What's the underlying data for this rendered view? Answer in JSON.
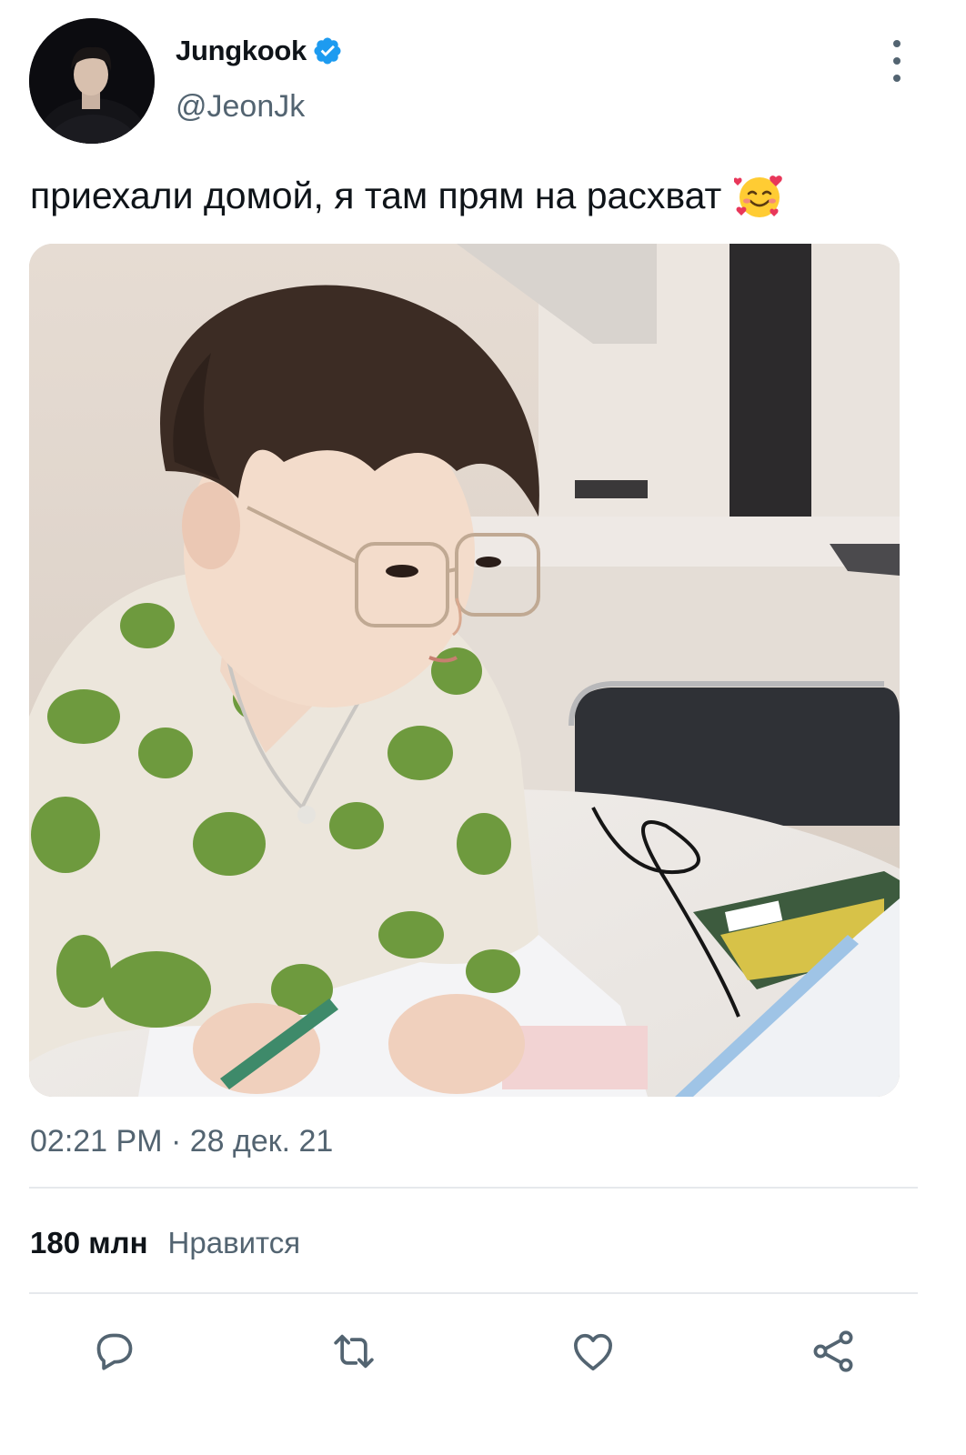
{
  "author": {
    "display_name": "Jungkook",
    "handle": "@JeonJk",
    "verified": true
  },
  "tweet": {
    "text": "приехали домой, я там прям на расхват",
    "emoji": "smiling-face-with-hearts",
    "timestamp": "02:21 PM · 28 дек. 21"
  },
  "stats": {
    "likes_count": "180 млн",
    "likes_label": "Нравится"
  },
  "actions": [
    "reply-icon",
    "retweet-icon",
    "like-icon",
    "share-icon"
  ],
  "colors": {
    "text_primary": "#0f1419",
    "text_secondary": "#536471",
    "verified_blue": "#1d9bf0",
    "divider": "#e6e9ec"
  }
}
